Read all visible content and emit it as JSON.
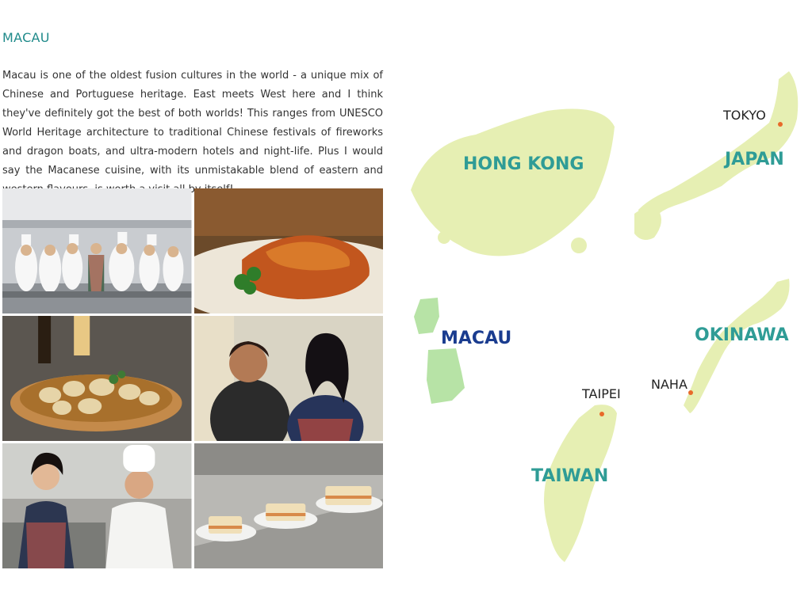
{
  "article": {
    "heading": "MACAU",
    "body": "Macau is one of the oldest fusion cultures in the world - a unique mix of Chinese and Portuguese heritage. East meets West here and I think they've definitely got the best of both worlds! This ranges from UNESCO World Heritage architecture to traditional Chinese festivals of fireworks and dragon boats, and ultra-modern hotels and night-life. Plus I would say the Macanese cuisine, with its unmistakable blend of eastern and western flavours, is worth a visit all by itself!"
  },
  "photos": [
    {
      "subject": "chefs-group-photo"
    },
    {
      "subject": "african-chicken-dish"
    },
    {
      "subject": "clams-dish"
    },
    {
      "subject": "cook-and-host-tasting"
    },
    {
      "subject": "host-and-chef-talking"
    },
    {
      "subject": "sandwich-plates"
    }
  ],
  "map": {
    "regions": {
      "hong_kong": "HONG KONG",
      "japan": "JAPAN",
      "macau": "MACAU",
      "okinawa": "OKINAWA",
      "taiwan": "TAIWAN"
    },
    "cities": {
      "tokyo": "TOKYO",
      "naha": "NAHA",
      "taipei": "TAIPEI"
    },
    "colors": {
      "land": "#e6efb3",
      "macau_land": "#b7e3a6",
      "label_teal": "#2f9c96",
      "label_macau": "#1a3c8f",
      "city_dot": "#e86a2a"
    }
  }
}
